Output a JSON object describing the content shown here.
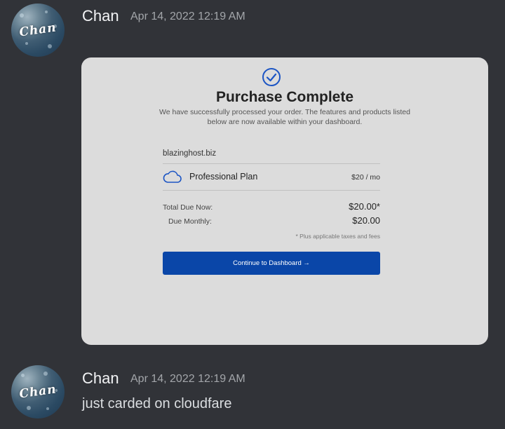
{
  "messages": [
    {
      "username": "Chan",
      "timestamp": "Apr 14, 2022 12:19 AM",
      "avatar_text": "Chan"
    },
    {
      "username": "Chan",
      "timestamp": "Apr 14, 2022 12:19 AM",
      "avatar_text": "Chan",
      "content": "just carded on cloudfare"
    }
  ],
  "attachment": {
    "check_icon": "check-circle-icon",
    "title": "Purchase Complete",
    "subtitle": "We have successfully processed your order. The features and products listed below are now available within your dashboard.",
    "domain": "blazinghost.biz",
    "plan_icon": "cloud-icon",
    "plan_name": "Professional Plan",
    "plan_price": "$20 / mo",
    "total_due_label": "Total Due Now:",
    "total_due_value": "$20.00*",
    "monthly_label": "Due Monthly:",
    "monthly_value": "$20.00",
    "tax_note": "* Plus applicable taxes and fees",
    "cta_label": "Continue to Dashboard →"
  },
  "colors": {
    "background": "#313338",
    "accent": "#0a46a8",
    "card": "#dcdcdc"
  }
}
